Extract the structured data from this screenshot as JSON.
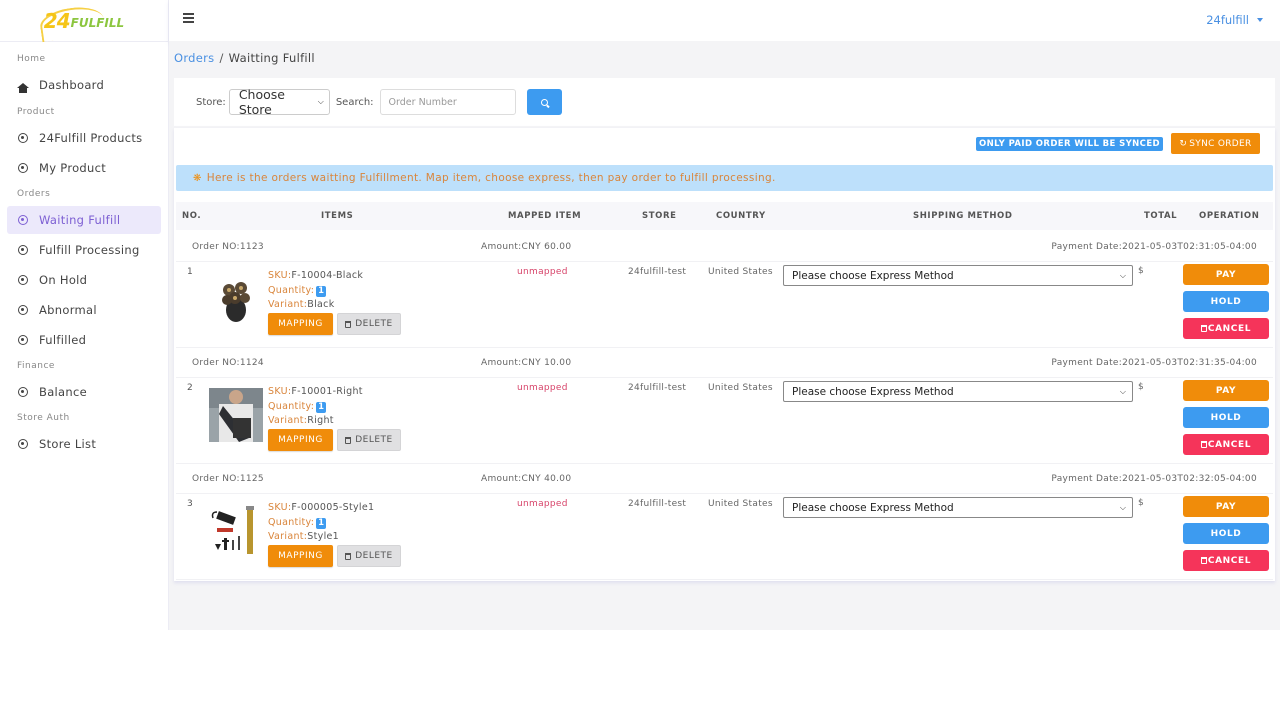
{
  "brand": {
    "logo_num": "24",
    "logo_text": "FULFILL"
  },
  "sidebar": {
    "sections": [
      {
        "title": "Home",
        "items": [
          {
            "label": "Dashboard",
            "icon": "home-icon",
            "active": false
          }
        ]
      },
      {
        "title": "Product",
        "items": [
          {
            "label": "24Fulfill Products",
            "icon": "circle-dot-icon",
            "active": false
          },
          {
            "label": "My Product",
            "icon": "circle-dot-icon",
            "active": false
          }
        ]
      },
      {
        "title": "Orders",
        "items": [
          {
            "label": "Waiting Fulfill",
            "icon": "circle-dot-icon",
            "active": true
          },
          {
            "label": "Fulfill Processing",
            "icon": "circle-dot-icon",
            "active": false
          },
          {
            "label": "On Hold",
            "icon": "circle-dot-icon",
            "active": false
          },
          {
            "label": "Abnormal",
            "icon": "circle-dot-icon",
            "active": false
          },
          {
            "label": "Fulfilled",
            "icon": "circle-dot-icon",
            "active": false
          }
        ]
      },
      {
        "title": "Finance",
        "items": [
          {
            "label": "Balance",
            "icon": "circle-dot-icon",
            "active": false
          }
        ]
      },
      {
        "title": "Store Auth",
        "items": [
          {
            "label": "Store List",
            "icon": "circle-dot-icon",
            "active": false
          }
        ]
      }
    ]
  },
  "header": {
    "user": "24fulfill"
  },
  "breadcrumb": {
    "parent": "Orders",
    "separator": "/",
    "current": "Waitting Fulfill"
  },
  "filter": {
    "store_label": "Store:",
    "store_value": "Choose Store",
    "search_label": "Search:",
    "search_placeholder": "Order Number",
    "search_value": ""
  },
  "sync": {
    "badge": "ONLY PAID ORDER WILL BE SYNCED",
    "button": "SYNC ORDER"
  },
  "alert": "Here is the orders waitting Fulfillment. Map item, choose express, then pay order to fulfill processing.",
  "table": {
    "columns": [
      "NO.",
      "ITEMS",
      "MAPPED ITEM",
      "STORE",
      "COUNTRY",
      "SHIPPING METHOD",
      "TOTAL",
      "OPERATION"
    ],
    "sku_label": "SKU:",
    "qty_label": "Quantity:",
    "variant_label": "Variant:",
    "mapping_label": "MAPPING",
    "delete_label": "DELETE",
    "pay_label": "PAY",
    "hold_label": "HOLD",
    "cancel_label": "CANCEL",
    "currency_symbol": "$",
    "orders": [
      {
        "order_no": "Order NO:1123",
        "amount": "Amount:CNY 60.00",
        "payment_date": "Payment Date:2021-05-03T02:31:05-04:00",
        "index": "1",
        "sku": "F-10004-Black",
        "quantity": "1",
        "variant": "Black",
        "mapped": "unmapped",
        "store": "24fulfill-test",
        "country": "United States",
        "shipping": "Please choose Express Method",
        "thumb": "shaver"
      },
      {
        "order_no": "Order NO:1124",
        "amount": "Amount:CNY 10.00",
        "payment_date": "Payment Date:2021-05-03T02:31:35-04:00",
        "index": "2",
        "sku": "F-10001-Right",
        "quantity": "1",
        "variant": "Right",
        "mapped": "unmapped",
        "store": "24fulfill-test",
        "country": "United States",
        "shipping": "Please choose Express Method",
        "thumb": "bag"
      },
      {
        "order_no": "Order NO:1125",
        "amount": "Amount:CNY 40.00",
        "payment_date": "Payment Date:2021-05-03T02:32:05-04:00",
        "index": "3",
        "sku": "F-000005-Style1",
        "quantity": "1",
        "variant": "Style1",
        "mapped": "unmapped",
        "store": "24fulfill-test",
        "country": "United States",
        "shipping": "Please choose Express Method",
        "thumb": "trimmer"
      }
    ]
  }
}
